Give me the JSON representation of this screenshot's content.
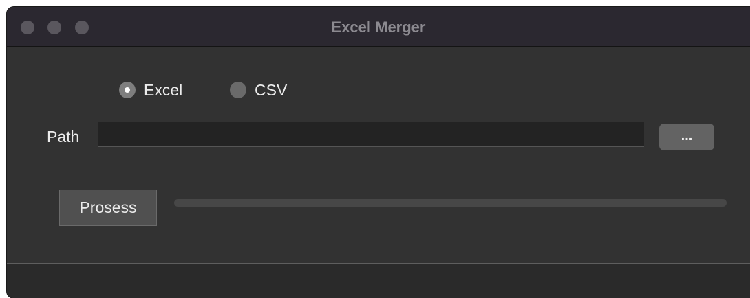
{
  "window": {
    "title": "Excel Merger"
  },
  "file_type": {
    "selected": "Excel",
    "options": [
      {
        "label": "Excel",
        "checked": true
      },
      {
        "label": "CSV",
        "checked": false
      }
    ]
  },
  "path": {
    "label": "Path",
    "value": "",
    "browse_label": "..."
  },
  "process": {
    "button_label": "Prosess",
    "progress_fraction": 0
  },
  "colors": {
    "window_background": "#323232",
    "titlebar_background": "#2b2830",
    "traffic_light": "#5a575e",
    "text": "#ececec"
  }
}
